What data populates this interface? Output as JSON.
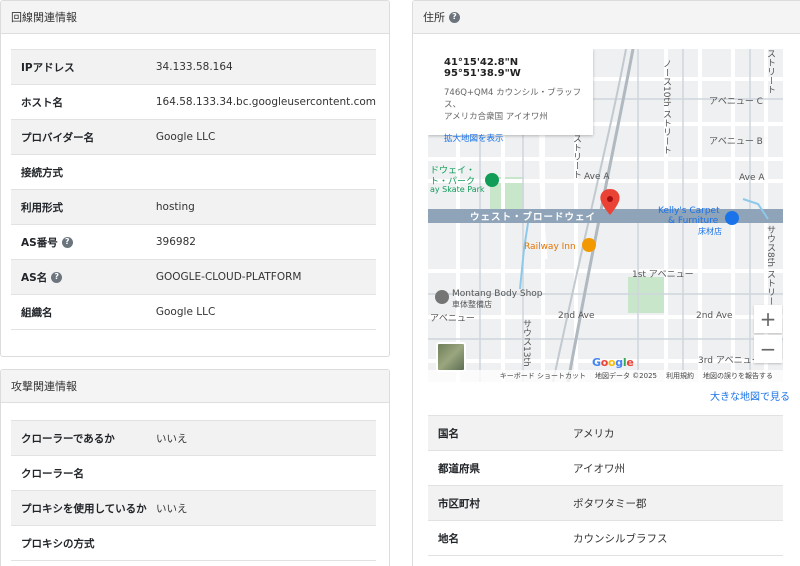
{
  "line_panel": {
    "title": "回線関連情報",
    "rows": [
      {
        "label": "IPアドレス",
        "value": "34.133.58.164",
        "help": false
      },
      {
        "label": "ホスト名",
        "value": "164.58.133.34.bc.googleusercontent.com",
        "help": false
      },
      {
        "label": "プロバイダー名",
        "value": "Google LLC",
        "help": false
      },
      {
        "label": "接続方式",
        "value": "",
        "help": false
      },
      {
        "label": "利用形式",
        "value": "hosting",
        "help": false
      },
      {
        "label": "AS番号",
        "value": "396982",
        "help": true
      },
      {
        "label": "AS名",
        "value": "GOOGLE-CLOUD-PLATFORM",
        "help": true
      },
      {
        "label": "組織名",
        "value": "Google LLC",
        "help": false
      }
    ]
  },
  "attack_panel": {
    "title": "攻撃関連情報",
    "rows": [
      {
        "label": "クローラーであるか",
        "value": "いいえ"
      },
      {
        "label": "クローラー名",
        "value": ""
      },
      {
        "label": "プロキシを使用しているか",
        "value": "いいえ"
      },
      {
        "label": "プロキシの方式",
        "value": ""
      }
    ]
  },
  "address_panel": {
    "title": "住所",
    "help_icon": "question-circle-icon",
    "big_map_link": "大きな地図で見る",
    "rows": [
      {
        "label": "国名",
        "value": "アメリカ"
      },
      {
        "label": "都道府県",
        "value": "アイオワ州"
      },
      {
        "label": "市区町村",
        "value": "ポタワタミー郡"
      },
      {
        "label": "地名",
        "value": "カウンシルブラフス"
      }
    ]
  },
  "map": {
    "coords": "41°15'42.8\"N 95°51'38.9\"W",
    "plus_code": "746Q+QM4 カウンシル・ブラッフス、",
    "plus_code_2": "アメリカ合衆国 アイオワ州",
    "enlarge_link": "拡大地図を表示",
    "zoom_in": "+",
    "zoom_out": "−",
    "labels": {
      "main_street": "ウェスト・ブロードウェイ",
      "ave_c": "アベニュー C",
      "ave_b": "アベニュー B",
      "ave_a_right": "Ave A",
      "ave_a_mid": "Ave A",
      "kellys_1": "Kelly's Carpet",
      "kellys_2": "& Furniture",
      "kellys_3": "床材店",
      "railway_inn": "Railway Inn",
      "first_ave": "1st アベニュー",
      "montang_1": "Montang Body Shop",
      "montang_2": "車体整備店",
      "second_ave_left": "2nd Ave",
      "second_ave_right": "2nd Ave",
      "avenue_left": "アベニュー",
      "third_ave": "3rd アベニュー",
      "skate_1": "ドウェイ・",
      "skate_2": "ト・パーク",
      "skate_3": "ay Skate Park",
      "north_10th": "ノース10th ストリート",
      "street_upper": "ストリート",
      "street_mid": "ストリート",
      "south_13th": "サウス13th",
      "south_8th": "サウス8th ストリート",
      "street_topright": "ストリート",
      "google": "Google"
    },
    "attribution": {
      "shortcuts": "キーボード ショートカット",
      "map_data": "地図データ ©2025",
      "terms": "利用規約",
      "report": "地図の誤りを報告する"
    },
    "colors": {
      "main_road": "#8fa4b8",
      "park": "#c8e6c9",
      "pin": "#ea4335",
      "link": "#1a73e8"
    }
  }
}
